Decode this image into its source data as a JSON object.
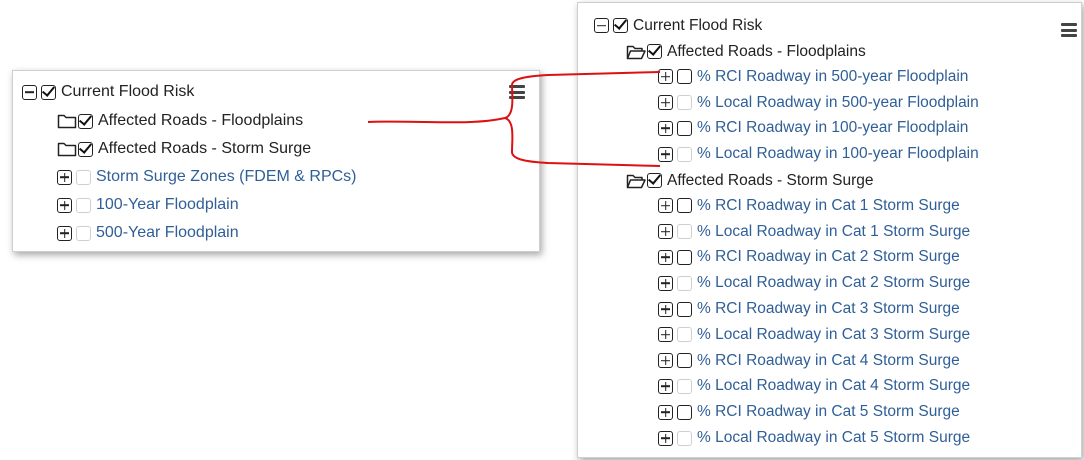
{
  "left_panel": {
    "root": {
      "label": "Current Flood Risk",
      "checked": true
    },
    "items": [
      {
        "label": "Affected Roads - Floodplains",
        "checked": true
      },
      {
        "label": "Affected Roads - Storm Surge",
        "checked": true
      },
      {
        "label": "Storm Surge Zones (FDEM & RPCs)",
        "checked": false
      },
      {
        "label": "100-Year Floodplain",
        "checked": false
      },
      {
        "label": "500-Year Floodplain",
        "checked": false
      }
    ]
  },
  "right_panel": {
    "root": {
      "label": "Current Flood Risk",
      "checked": true
    },
    "groups": [
      {
        "label": "Affected Roads - Floodplains",
        "checked": true,
        "expanded": true,
        "children": [
          "% RCI Roadway in 500-year Floodplain",
          "% Local Roadway in 500-year Floodplain",
          "% RCI Roadway in 100-year Floodplain",
          "% Local Roadway in 100-year Floodplain"
        ]
      },
      {
        "label": "Affected Roads - Storm Surge",
        "checked": true,
        "expanded": true,
        "children": [
          "% RCI Roadway in Cat 1 Storm Surge",
          "% Local Roadway in Cat 1 Storm Surge",
          "% RCI Roadway in Cat 2 Storm Surge",
          "% Local Roadway in Cat 2 Storm Surge",
          "% RCI Roadway in Cat 3 Storm Surge",
          "% Local Roadway in Cat 3 Storm Surge",
          "% RCI Roadway in Cat 4 Storm Surge",
          "% Local Roadway in Cat 4 Storm Surge",
          "% RCI Roadway in Cat 5 Storm Surge",
          "% Local Roadway in Cat 5 Storm Surge"
        ]
      }
    ]
  },
  "colors": {
    "link_text": "#2f5f97",
    "plain_text": "#222222",
    "connector": "#dd1111",
    "unchecked_muted_border": "#cfcfcf"
  },
  "icons": [
    "collapse-icon",
    "expand-icon",
    "checkbox-checked",
    "checkbox-unchecked",
    "folder-icon",
    "folder-open-icon",
    "hamburger-menu-icon"
  ]
}
